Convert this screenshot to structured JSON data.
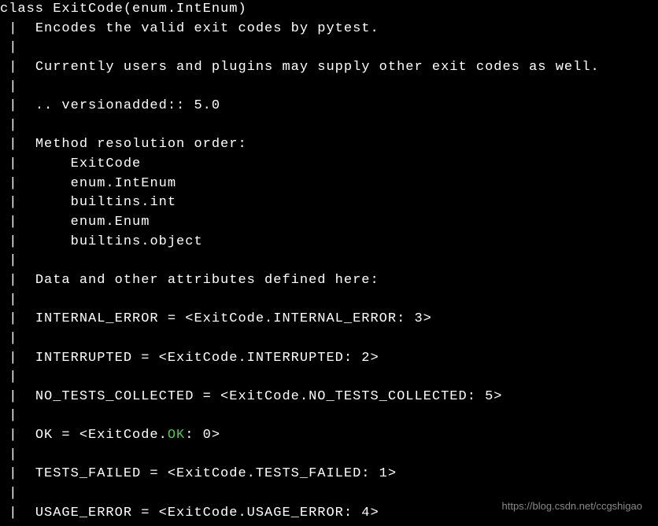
{
  "terminal": {
    "class_def": "class ExitCode(enum.IntEnum)",
    "desc1": "Encodes the valid exit codes by pytest.",
    "desc2": "Currently users and plugins may supply other exit codes as well.",
    "version": ".. versionadded:: 5.0",
    "mro_header": "Method resolution order:",
    "mro": {
      "item0": "ExitCode",
      "item1": "enum.IntEnum",
      "item2": "builtins.int",
      "item3": "enum.Enum",
      "item4": "builtins.object"
    },
    "data_header": "Data and other attributes defined here:",
    "attrs": {
      "internal_error": "INTERNAL_ERROR = <ExitCode.INTERNAL_ERROR: 3>",
      "interrupted": "INTERRUPTED = <ExitCode.INTERRUPTED: 2>",
      "no_tests": "NO_TESTS_COLLECTED = <ExitCode.NO_TESTS_COLLECTED: 5>",
      "ok_pre": "OK = <ExitCode.",
      "ok_highlight": "OK",
      "ok_post": ": 0>",
      "tests_failed": "TESTS_FAILED = <ExitCode.TESTS_FAILED: 1>",
      "usage_error": "USAGE_ERROR = <ExitCode.USAGE_ERROR: 4>"
    },
    "pipe": " |  ",
    "pipe_indent": " |      "
  },
  "watermark": "https://blog.csdn.net/ccgshigao"
}
